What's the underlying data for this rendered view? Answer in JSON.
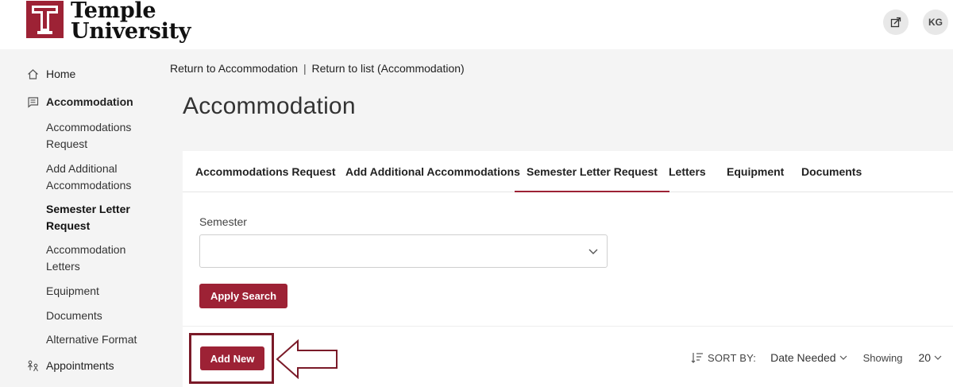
{
  "header": {
    "logo_line1": "Temple",
    "logo_line2": "University",
    "user_initials": "KG",
    "brand_color": "#9d2235",
    "external_icon": "external-link-icon"
  },
  "sidebar": {
    "items": [
      {
        "label": "Home",
        "icon": "home-icon"
      },
      {
        "label": "Accommodation",
        "icon": "chat-list-icon"
      }
    ],
    "sub_items": [
      {
        "label": "Accommodations Request"
      },
      {
        "label": "Add Additional Accommodations"
      },
      {
        "label": "Semester Letter Request"
      },
      {
        "label": "Accommodation Letters"
      },
      {
        "label": "Equipment"
      },
      {
        "label": "Documents"
      },
      {
        "label": "Alternative Format"
      }
    ],
    "appointments": {
      "label": "Appointments",
      "icon": "people-icon"
    }
  },
  "breadcrumb": {
    "link1": "Return to Accommodation",
    "separator": "|",
    "link2": "Return to list (Accommodation)"
  },
  "page_title": "Accommodation",
  "tabs": [
    {
      "label": "Accommodations Request"
    },
    {
      "label": "Add Additional Accommodations"
    },
    {
      "label": "Semester Letter Request"
    },
    {
      "label": "Letters"
    },
    {
      "label": "Equipment"
    },
    {
      "label": "Documents"
    }
  ],
  "active_tab": "Semester Letter Request",
  "form": {
    "semester_label": "Semester",
    "semester_value": "",
    "apply_label": "Apply Search"
  },
  "actions": {
    "add_new_label": "Add New"
  },
  "sorting": {
    "sort_by_label": "SORT BY:",
    "sort_value": "Date Needed",
    "showing_label": "Showing",
    "page_size": "20"
  }
}
